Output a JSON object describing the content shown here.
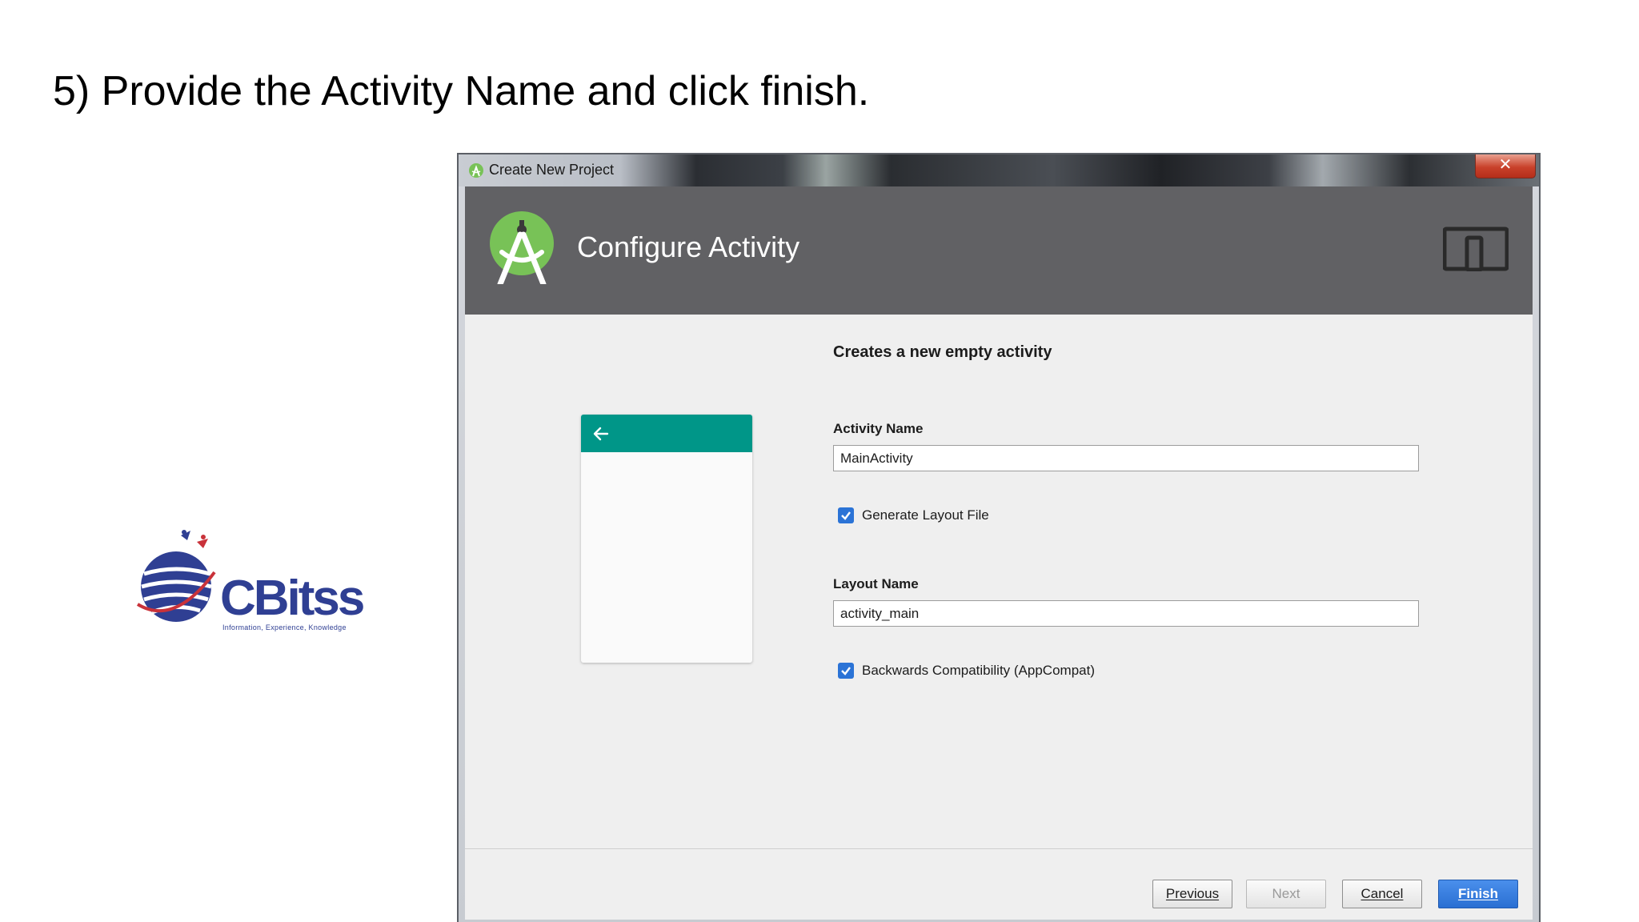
{
  "slide": {
    "title": "5) Provide the Activity Name and click finish."
  },
  "logo": {
    "wordmark": "CBitss",
    "tagline": "Information, Experience, Knowledge"
  },
  "window": {
    "title": "Create New Project",
    "close_glyph": "✕",
    "header_title": "Configure Activity",
    "form": {
      "title": "Creates a new empty activity",
      "activity_name_label": "Activity Name",
      "activity_name_value": "MainActivity",
      "generate_layout_label": "Generate Layout File",
      "generate_layout_checked": true,
      "layout_name_label": "Layout Name",
      "layout_name_value": "activity_main",
      "backwards_compat_label": "Backwards Compatibility (AppCompat)",
      "backwards_compat_checked": true
    },
    "buttons": {
      "previous": "Previous",
      "next": "Next",
      "cancel": "Cancel",
      "finish": "Finish"
    }
  },
  "colors": {
    "header_band": "#616164",
    "app_bar": "#009688",
    "checkbox": "#2b73d6",
    "primary_button": "#2a6fd2",
    "close_button": "#c9412b",
    "logo_blue": "#2f3f93"
  },
  "icons": {
    "window_icon": "android-studio-icon",
    "header_logo": "android-studio-logo-icon",
    "form_factor": "phone-tablet-icon",
    "back": "back-arrow-icon",
    "check": "checkmark-icon"
  }
}
